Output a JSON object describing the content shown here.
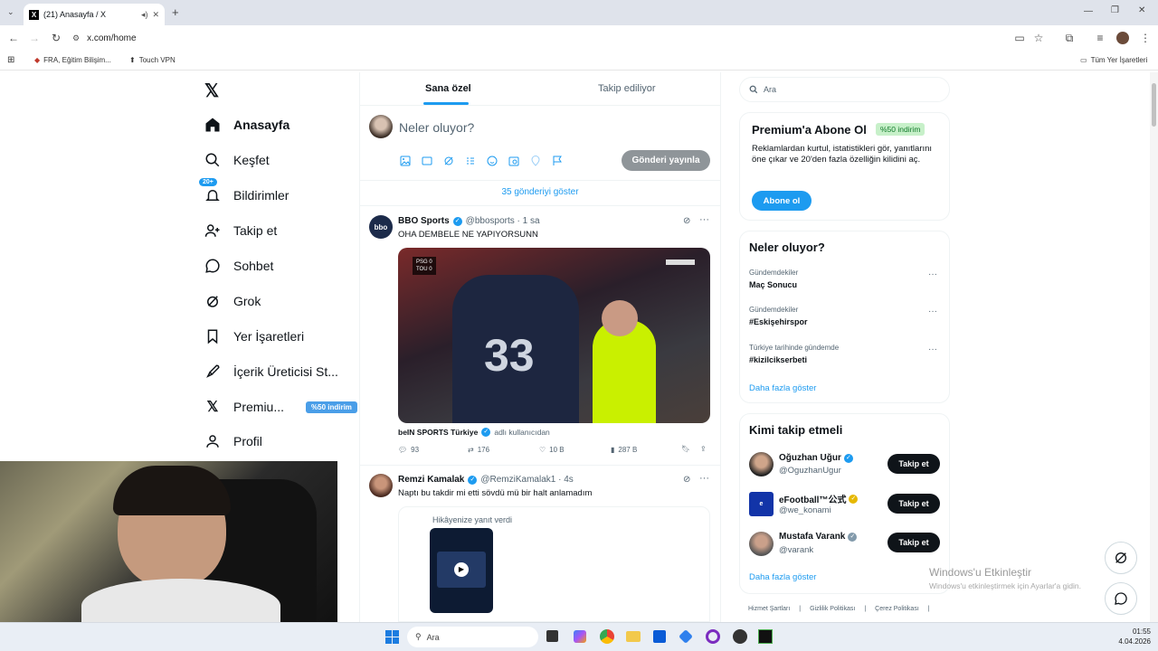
{
  "browser": {
    "tab_title": "(21) Anasayfa / X",
    "url": "x.com/home",
    "bookmarks": [
      "FRA, Eğitim Bilişim...",
      "Touch VPN"
    ],
    "all_bookmarks": "Tüm Yer İşaretleri"
  },
  "nav": {
    "items": [
      {
        "label": "Anasayfa",
        "icon": "home-icon"
      },
      {
        "label": "Keşfet",
        "icon": "search-icon"
      },
      {
        "label": "Bildirimler",
        "icon": "bell-icon",
        "badge": "20+"
      },
      {
        "label": "Takip et",
        "icon": "add-user-icon"
      },
      {
        "label": "Sohbet",
        "icon": "chat-icon"
      },
      {
        "label": "Grok",
        "icon": "grok-icon"
      },
      {
        "label": "Yer İşaretleri",
        "icon": "bookmark-icon"
      },
      {
        "label": "İçerik Üreticisi St...",
        "icon": "rocket-icon"
      },
      {
        "label": "Premiu...",
        "icon": "x-icon",
        "badge": "%50 indirim"
      },
      {
        "label": "Profil",
        "icon": "user-icon"
      }
    ]
  },
  "feed": {
    "tabs": [
      "Sana özel",
      "Takip ediliyor"
    ],
    "compose_placeholder": "Neler oluyor?",
    "post_button": "Gönderi yayınla",
    "show_more": "35 gönderiyi göster",
    "posts": [
      {
        "name": "BBO Sports",
        "handle": "@bbosports · 1 sa",
        "text": "OHA DEMBELE NE YAPIYORSUNN",
        "source": "beIN SPORTS Türkiye",
        "source_suffix": "adlı kullanıcıdan",
        "scoreboard": [
          "PSG 0",
          "TOU 0"
        ],
        "stats": {
          "replies": "93",
          "reposts": "176",
          "likes": "10 B",
          "views": "287 B"
        }
      },
      {
        "name": "Remzi Kamalak",
        "handle": "@RemziKamalak1 · 4s",
        "text": "Naptı bu takdir mi etti sövdü mü bir halt anlamadım",
        "quote_label": "Hikâyenize yanıt verdi"
      }
    ]
  },
  "right": {
    "search_placeholder": "Ara",
    "premium": {
      "title": "Premium'a Abone Ol",
      "badge": "%50 indirim",
      "text": "Reklamlardan kurtul, istatistikleri gör, yanıtlarını öne çıkar ve 20'den fazla özelliğin kilidini aç.",
      "button": "Abone ol"
    },
    "trends": {
      "title": "Neler oluyor?",
      "items": [
        {
          "category": "Gündemdekiler",
          "name": "Maç Sonucu"
        },
        {
          "category": "Gündemdekiler",
          "name": "#Eskişehirspor"
        },
        {
          "category": "Türkiye tarihinde gündemde",
          "name": "#kizilcikserbeti"
        }
      ],
      "more": "Daha fazla göster"
    },
    "who_to_follow": {
      "title": "Kimi takip etmeli",
      "items": [
        {
          "name": "Oğuzhan Uğur",
          "handle": "@OguzhanUgur",
          "badge": "blue"
        },
        {
          "name": "eFootball™公式",
          "handle": "@we_konami",
          "badge": "gold"
        },
        {
          "name": "Mustafa Varank",
          "handle": "@varank",
          "badge": "grey"
        }
      ],
      "follow_label": "Takip et",
      "more": "Daha fazla göster"
    },
    "footer_links": [
      "Hizmet Şartları",
      "Gizlilik Politikası",
      "Çerez Politikası"
    ]
  },
  "watermark": {
    "line1": "Windows'u Etkinleştir",
    "line2": "Windows'u etkinleştirmek için Ayarlar'a gidin."
  },
  "taskbar": {
    "search": "Ara",
    "time": "01:55",
    "date": "4.04.2026"
  },
  "colors": {
    "accent": "#1d9bf0",
    "premium_badge_bg": "#c7f0c9",
    "premium_badge_fg": "#127a2b"
  }
}
